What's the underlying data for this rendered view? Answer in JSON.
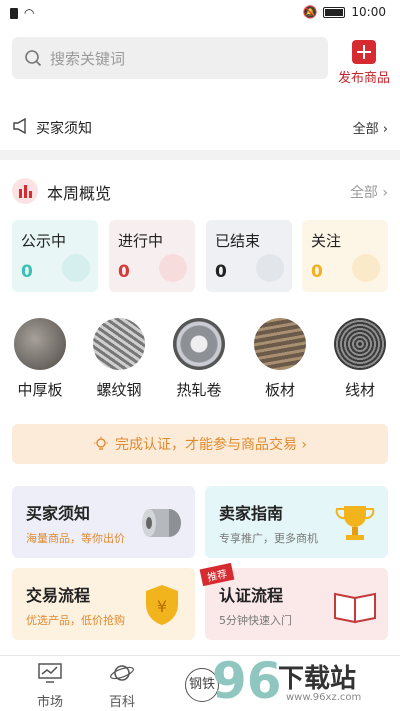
{
  "status": {
    "time": "10:00"
  },
  "search": {
    "placeholder": "搜索关键词"
  },
  "publish": {
    "label": "发布商品"
  },
  "notice": {
    "title": "买家须知",
    "more": "全部 ›"
  },
  "week": {
    "title": "本周概览",
    "more": "全部 ›"
  },
  "stats": [
    {
      "label": "公示中",
      "value": "0",
      "color": "#3cbfb4",
      "bg": "#e8f7f6"
    },
    {
      "label": "进行中",
      "value": "0",
      "color": "#d43b3b",
      "bg": "#f7efef"
    },
    {
      "label": "已结束",
      "value": "0",
      "color": "#222222",
      "bg": "#eef0f4"
    },
    {
      "label": "关注",
      "value": "0",
      "color": "#f0b021",
      "bg": "#fdf5e6"
    }
  ],
  "categories": [
    "中厚板",
    "螺纹钢",
    "热轧卷",
    "板材",
    "线材"
  ],
  "cert": {
    "text": "完成认证，才能参与商品交易 ›"
  },
  "tiles": [
    {
      "title": "买家须知",
      "sub": "海量商品，等你出价",
      "subcolor": "#e08b2e",
      "bg": "#eeeef9"
    },
    {
      "title": "卖家指南",
      "sub": "专享推广，更多商机",
      "subcolor": "#777777",
      "bg": "#e4f6f7"
    },
    {
      "title": "交易流程",
      "sub": "优选产品，低价抢购",
      "subcolor": "#e08b2e",
      "bg": "#fdf1df"
    },
    {
      "title": "认证流程",
      "sub": "5分钟快速入门",
      "subcolor": "#777777",
      "bg": "#fbe9e9",
      "badge": "推荐"
    }
  ],
  "tabs": [
    {
      "label": "市场"
    },
    {
      "label": "百科"
    },
    {
      "label": "钢铁"
    }
  ],
  "watermark": {
    "brand": "下载站",
    "url": "www.96xz.com"
  }
}
